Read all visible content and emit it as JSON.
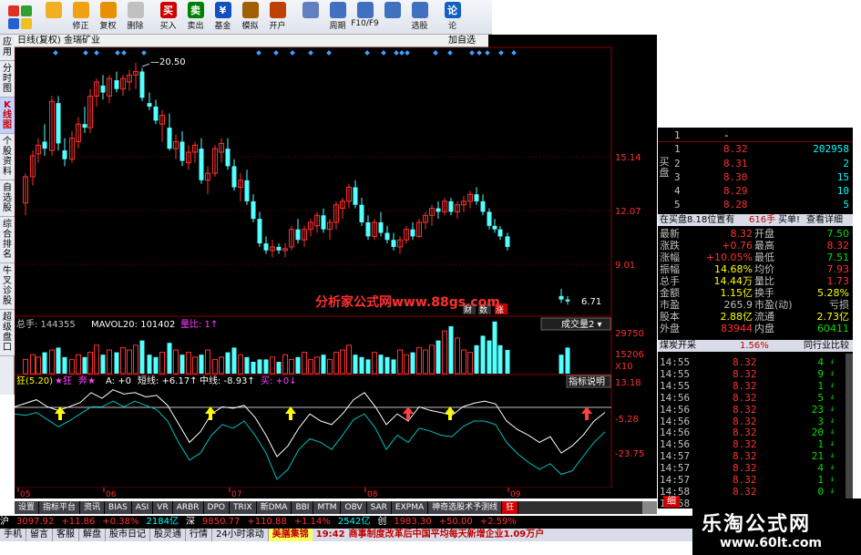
{
  "toolbar": {
    "buttons": [
      {
        "label": "",
        "icon": "back-arrow-icon",
        "color": "#f0b020"
      },
      {
        "label": "修正",
        "icon": "up-down-icon",
        "color": "#f0a010"
      },
      {
        "label": "复权",
        "icon": "restore-icon",
        "color": "#e89000"
      },
      {
        "label": "删除",
        "icon": "clock-icon",
        "color": "#c0c0c0"
      },
      {
        "label": "买入",
        "icon": "buy-icon",
        "color": "#d00000",
        "glyph": "买"
      },
      {
        "label": "卖出",
        "icon": "sell-icon",
        "color": "#008000",
        "glyph": "卖"
      },
      {
        "label": "基金",
        "icon": "fund-icon",
        "color": "#1050c0",
        "glyph": "¥"
      },
      {
        "label": "模拟",
        "icon": "hammer-icon",
        "color": "#a06000"
      },
      {
        "label": "开户",
        "icon": "house-icon",
        "color": "#c04000"
      },
      {
        "label": "",
        "icon": "window-icon",
        "color": "#6080c0"
      },
      {
        "label": "周期",
        "icon": "period-icon",
        "color": "#4070c0"
      },
      {
        "label": "F10/F9",
        "icon": "doc-icon",
        "color": "#4070c0"
      },
      {
        "label": "",
        "icon": "grid-icon",
        "color": "#4070c0"
      },
      {
        "label": "选股",
        "icon": "select-icon",
        "color": "#4070c0"
      },
      {
        "label": "论",
        "icon": "forum-icon",
        "color": "#1060c0",
        "glyph": "论"
      }
    ]
  },
  "left_tabs": [
    {
      "label": "应用",
      "active": false
    },
    {
      "label": "分时图",
      "active": false
    },
    {
      "label": "K线图",
      "active": true
    },
    {
      "label": "个股资料",
      "active": false
    },
    {
      "label": "自选股",
      "active": false
    },
    {
      "label": "综合排名",
      "active": false
    },
    {
      "label": "牛叉诊股",
      "active": false
    },
    {
      "label": "超级盘口",
      "active": false
    }
  ],
  "chart": {
    "header_title": "日线(复权) 金瑞矿业",
    "add_fav": "加自选",
    "price_axis": [
      "15.14",
      "12.07",
      "9.01"
    ],
    "high_label": "20.50",
    "low_label": "6.71",
    "watermark_text": "分析家公式网www.88gs.com",
    "tags": [
      "财",
      "数",
      "涨"
    ],
    "volume_header": {
      "total_label": "总手: 144355",
      "mavol_label": "MAVOL20: 101402",
      "ratio_label": "量比: 1"
    },
    "volume_selector": "成交量2",
    "volume_axis": [
      "29750",
      "15206",
      "X10"
    ],
    "osc_header": {
      "title": "狂(5.20)",
      "star1": "★狂",
      "star2": "奔★",
      "a_label": "A: +0",
      "short_label": "短线: +6.17",
      "mid_label": "中线: -8.93",
      "buy_label": "买: +0"
    },
    "osc_button": "指标说明",
    "osc_axis": [
      "13.18",
      "-5.28",
      "-23.75"
    ],
    "x_axis": [
      "05",
      "06",
      "07",
      "08",
      "09"
    ]
  },
  "bottom_tabs": [
    "设置",
    "指标平台",
    "资讯",
    "BIAS",
    "ASI",
    "VR",
    "ARBR",
    "DPO",
    "TRIX",
    "新DMA",
    "BBI",
    "MTM",
    "OBV",
    "SAR",
    "EXPMA",
    "神奇选股术予测线",
    "狂"
  ],
  "status_bar": {
    "sh_label": "沪",
    "sh_index": "3097.92",
    "sh_change": "+11.86",
    "sh_pct": "+0.38%",
    "sh_amount": "2184亿",
    "sz_label": "深",
    "sz_index": "9850.77",
    "sz_change": "+110.88",
    "sz_pct": "+1.14%",
    "sz_amount": "2542亿",
    "cy_label": "创",
    "cy_index": "1983.30",
    "cy_change": "+50.00",
    "cy_pct": "+2.59%"
  },
  "ticker": {
    "items": [
      "手机",
      "留言",
      "客服",
      "解盘",
      "股市日记",
      "股灵通",
      "行情",
      "24小时滚动"
    ],
    "ad": "美膳集锦",
    "time": "19:42",
    "news": "商事制度改革后中国平均每天新增企业1.09万户",
    "clock": "15:53"
  },
  "order_book": {
    "sell_label": "卖",
    "buy_label": "买盘",
    "rows": [
      {
        "n": "1",
        "price": "-",
        "vol": "",
        "price_color": "white"
      },
      {
        "n": "1",
        "price": "8.32",
        "vol": "202958",
        "price_color": "red"
      },
      {
        "n": "2",
        "price": "8.31",
        "vol": "2",
        "price_color": "red"
      },
      {
        "n": "3",
        "price": "8.30",
        "vol": "15",
        "price_color": "red"
      },
      {
        "n": "4",
        "price": "8.29",
        "vol": "10",
        "price_color": "red"
      },
      {
        "n": "5",
        "price": "8.28",
        "vol": "5",
        "price_color": "red"
      }
    ]
  },
  "pending": {
    "label": "在买盘8.18位置有",
    "qty": "616手",
    "buy_link": "买单!",
    "detail_link": "查看详细"
  },
  "quote": [
    {
      "l": "最新",
      "v": "8.32",
      "c": "red",
      "l2": "开盘",
      "v2": "7.50",
      "c2": "green"
    },
    {
      "l": "涨跌",
      "v": "+0.76",
      "c": "red",
      "l2": "最高",
      "v2": "8.32",
      "c2": "red"
    },
    {
      "l": "涨幅",
      "v": "+10.05%",
      "c": "red",
      "l2": "最低",
      "v2": "7.51",
      "c2": "green"
    },
    {
      "l": "振幅",
      "v": "14.68%",
      "c": "yellow",
      "l2": "均价",
      "v2": "7.93",
      "c2": "red"
    },
    {
      "l": "总手",
      "v": "14.44万",
      "c": "yellow",
      "l2": "量比",
      "v2": "1.73",
      "c2": "red"
    },
    {
      "l": "金额",
      "v": "1.15亿",
      "c": "yellow",
      "l2": "换手",
      "v2": "5.28%",
      "c2": "yellow"
    },
    {
      "l": "市盈",
      "v": "265.9",
      "c": "gray",
      "l2": "市盈(动)",
      "v2": "亏损",
      "c2": "gray"
    },
    {
      "l": "股本",
      "v": "2.88亿",
      "c": "yellow",
      "l2": "流通",
      "v2": "2.73亿",
      "c2": "yellow"
    },
    {
      "l": "外盘",
      "v": "83944",
      "c": "red",
      "l2": "内盘",
      "v2": "60411",
      "c2": "green"
    }
  ],
  "bar2": {
    "left": "煤炭开采",
    "pct": "1.56%",
    "right": "同行业比较"
  },
  "trades": [
    {
      "t": "14:55",
      "p": "8.32",
      "v": "4"
    },
    {
      "t": "14:55",
      "p": "8.32",
      "v": "9"
    },
    {
      "t": "14:55",
      "p": "8.32",
      "v": "1"
    },
    {
      "t": "14:56",
      "p": "8.32",
      "v": "5"
    },
    {
      "t": "14:56",
      "p": "8.32",
      "v": "23"
    },
    {
      "t": "14:56",
      "p": "8.32",
      "v": "3"
    },
    {
      "t": "14:56",
      "p": "8.32",
      "v": "20"
    },
    {
      "t": "14:56",
      "p": "8.32",
      "v": "1"
    },
    {
      "t": "14:57",
      "p": "8.32",
      "v": "21"
    },
    {
      "t": "14:57",
      "p": "8.32",
      "v": "4"
    },
    {
      "t": "14:57",
      "p": "8.32",
      "v": "1"
    },
    {
      "t": "14:58",
      "p": "8.32",
      "v": "0"
    },
    {
      "t": "14:58",
      "p": "8.32",
      "v": "0"
    }
  ],
  "trades_tab": "细",
  "watermark": {
    "line1": "乐淘公式网",
    "line2": "www.60lt.com"
  },
  "colors": {
    "up": "#ff3030",
    "down": "#00ffff",
    "bg": "#000000",
    "grid": "#8b0000"
  }
}
